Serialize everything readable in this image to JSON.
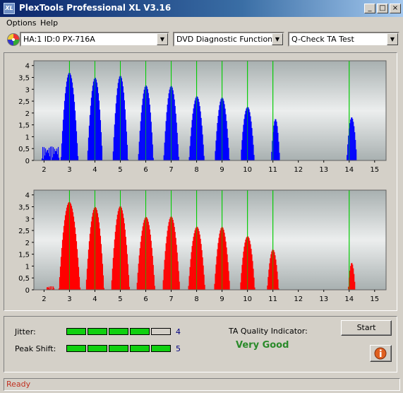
{
  "window": {
    "title": "PlexTools Professional XL V3.16",
    "icon_text": "XL",
    "controls": [
      "minimize",
      "maximize",
      "close"
    ]
  },
  "menu": [
    "Options",
    "Help"
  ],
  "toolbar": {
    "drive": "HA:1 ID:0  PX-716A",
    "function": "DVD Diagnostic Functions",
    "test": "Q-Check TA Test"
  },
  "charts": {
    "top_color": "#0000ff",
    "bottom_color": "#ff0000",
    "marker_color": "#00cc00"
  },
  "chart_data": [
    {
      "type": "bar",
      "name": "top",
      "color": "#0000ff",
      "x_ticks": [
        "2",
        "3",
        "4",
        "5",
        "6",
        "7",
        "8",
        "9",
        "10",
        "11",
        "12",
        "13",
        "14",
        "15"
      ],
      "y_ticks": [
        "0",
        "0,5",
        "1",
        "1,5",
        "2",
        "2,5",
        "3",
        "3,5",
        "4"
      ],
      "xlim": [
        1.6,
        15.45
      ],
      "ylim": [
        0,
        4.2
      ],
      "markers": [
        3,
        4,
        5,
        6,
        7,
        8,
        9,
        10,
        11,
        14
      ],
      "peaks": [
        {
          "x": 3,
          "y": 3.75,
          "w": 0.34
        },
        {
          "x": 4,
          "y": 3.7,
          "w": 0.3
        },
        {
          "x": 5,
          "y": 3.6,
          "w": 0.3
        },
        {
          "x": 6,
          "y": 3.4,
          "w": 0.3
        },
        {
          "x": 7,
          "y": 3.15,
          "w": 0.3
        },
        {
          "x": 8,
          "y": 2.95,
          "w": 0.3
        },
        {
          "x": 9,
          "y": 2.65,
          "w": 0.29
        },
        {
          "x": 10,
          "y": 2.5,
          "w": 0.27
        },
        {
          "x": 11.1,
          "y": 1.75,
          "w": 0.17
        },
        {
          "x": 14.1,
          "y": 2.0,
          "w": 0.2
        }
      ],
      "noise_range": [
        1.9,
        2.6
      ],
      "noise_level": 0.6
    },
    {
      "type": "bar",
      "name": "bottom",
      "color": "#ff0000",
      "x_ticks": [
        "2",
        "3",
        "4",
        "5",
        "6",
        "7",
        "8",
        "9",
        "10",
        "11",
        "12",
        "13",
        "14",
        "15"
      ],
      "y_ticks": [
        "0",
        "0,5",
        "1",
        "1,5",
        "2",
        "2,5",
        "3",
        "3,5",
        "4"
      ],
      "xlim": [
        1.6,
        15.45
      ],
      "ylim": [
        0,
        4.2
      ],
      "markers": [
        3,
        4,
        5,
        6,
        7,
        8,
        9,
        10,
        11,
        14
      ],
      "peaks": [
        {
          "x": 3,
          "y": 3.75,
          "w": 0.42
        },
        {
          "x": 4,
          "y": 3.7,
          "w": 0.36
        },
        {
          "x": 5,
          "y": 3.55,
          "w": 0.36
        },
        {
          "x": 6,
          "y": 3.3,
          "w": 0.36
        },
        {
          "x": 7,
          "y": 3.1,
          "w": 0.34
        },
        {
          "x": 8,
          "y": 2.9,
          "w": 0.33
        },
        {
          "x": 9,
          "y": 2.65,
          "w": 0.31
        },
        {
          "x": 10,
          "y": 2.5,
          "w": 0.29
        },
        {
          "x": 11,
          "y": 1.7,
          "w": 0.23
        },
        {
          "x": 14.1,
          "y": 1.25,
          "w": 0.14
        }
      ],
      "noise_range": [
        2.1,
        2.4
      ],
      "noise_level": 0.15
    }
  ],
  "results": {
    "jitter_label": "Jitter:",
    "jitter_value": "4",
    "jitter_level": 4,
    "peak_shift_label": "Peak Shift:",
    "peak_shift_value": "5",
    "peak_shift_level": 5,
    "level_max": 5,
    "ta_label": "TA Quality Indicator:",
    "ta_value": "Very Good",
    "ta_color": "#2a8a2a",
    "start_label": "Start",
    "info_icon": "info-icon"
  },
  "status": {
    "text": "Ready"
  }
}
